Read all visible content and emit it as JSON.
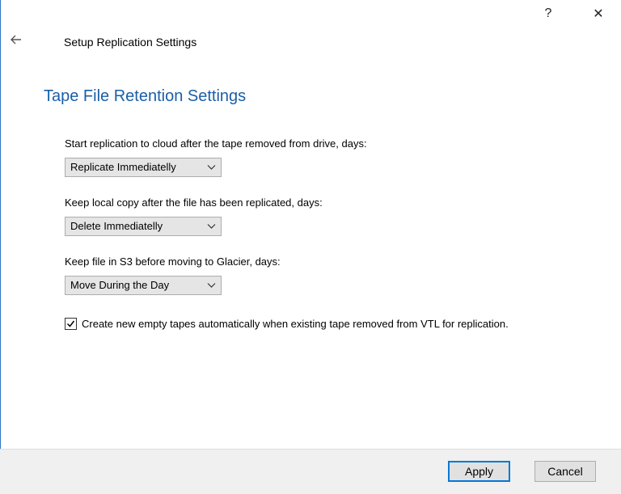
{
  "window": {
    "help_label": "?",
    "close_label": "✕"
  },
  "header": {
    "title": "Setup Replication Settings"
  },
  "section": {
    "heading": "Tape File Retention Settings"
  },
  "fields": [
    {
      "label": "Start replication to cloud after the tape removed from drive, days:",
      "selected": "Replicate Immediatelly"
    },
    {
      "label": "Keep local copy after the file has been replicated, days:",
      "selected": "Delete Immediatelly"
    },
    {
      "label": "Keep file in S3 before moving to Glacier, days:",
      "selected": "Move During the Day"
    }
  ],
  "auto_create": {
    "checked": true,
    "label": "Create new empty tapes automatically when existing tape removed from VTL for replication."
  },
  "footer": {
    "apply_label": "Apply",
    "cancel_label": "Cancel"
  },
  "colors": {
    "heading": "#1a5fa8",
    "default_button_border": "#0078d7"
  }
}
